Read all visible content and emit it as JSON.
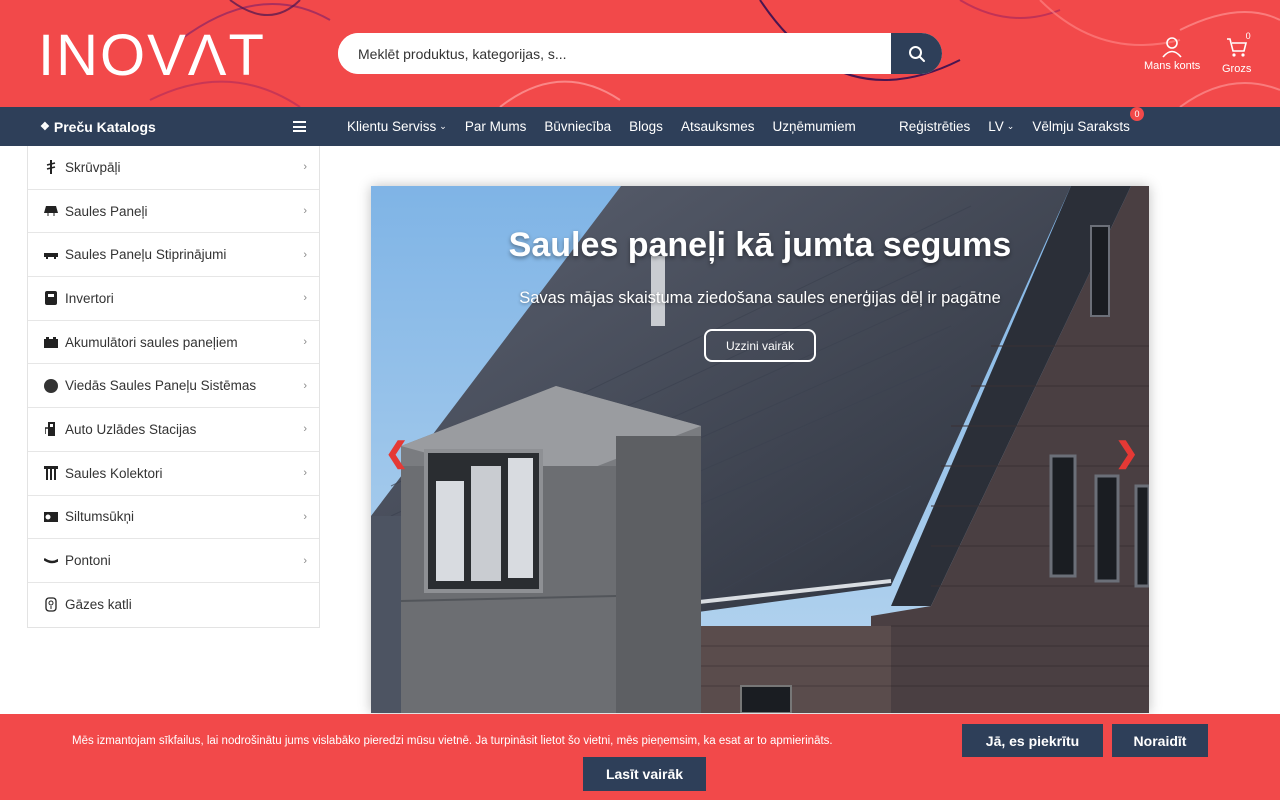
{
  "header": {
    "logo_text": "INOVΛT",
    "search": {
      "placeholder": "Meklēt produktus, kategorijas, s...",
      "value": ""
    },
    "account_label": "Mans konts",
    "cart_label": "Grozs",
    "cart_count": "0"
  },
  "nav": {
    "catalog_label": "Preču Katalogs",
    "items": [
      {
        "label": "Klientu Serviss",
        "has_dropdown": true
      },
      {
        "label": "Par Mums",
        "has_dropdown": false
      },
      {
        "label": "Būvniecība",
        "has_dropdown": false
      },
      {
        "label": "Blogs",
        "has_dropdown": false
      },
      {
        "label": "Atsauksmes",
        "has_dropdown": false
      },
      {
        "label": "Uzņēmumiem",
        "has_dropdown": false
      }
    ],
    "right": {
      "register_label": "Reģistrēties",
      "language_label": "LV",
      "wishlist_label": "Vēlmju Saraksts",
      "wishlist_count": "0"
    }
  },
  "sidebar": {
    "items": [
      {
        "label": "Skrūvpāļi",
        "icon": "screw-pile-icon"
      },
      {
        "label": "Saules Paneļi",
        "icon": "solar-panel-icon"
      },
      {
        "label": "Saules Paneļu Stiprinājumi",
        "icon": "mount-icon"
      },
      {
        "label": "Invertori",
        "icon": "inverter-icon"
      },
      {
        "label": "Akumulātori saules paneļiem",
        "icon": "battery-icon"
      },
      {
        "label": "Viedās Saules Paneļu Sistēmas",
        "icon": "smart-system-icon"
      },
      {
        "label": "Auto Uzlādes Stacijas",
        "icon": "ev-charger-icon"
      },
      {
        "label": "Saules Kolektori",
        "icon": "solar-collector-icon"
      },
      {
        "label": "Siltumsūkņi",
        "icon": "heat-pump-icon"
      },
      {
        "label": "Pontoni",
        "icon": "pontoon-icon"
      },
      {
        "label": "Gāzes katli",
        "icon": "gas-boiler-icon"
      }
    ]
  },
  "hero": {
    "title": "Saules paneļi kā jumta segums",
    "subtitle": "Savas mājas skaistuma ziedošana saules enerģijas dēļ ir pagātne",
    "button_label": "Uzzini vairāk",
    "prev_icon": "chevron-left-icon",
    "next_icon": "chevron-right-icon"
  },
  "cookie": {
    "text": "Mēs izmantojam sīkfailus, lai nodrošinātu jums vislabāko pieredzi mūsu vietnē. Ja turpināsit lietot šo vietni, mēs pieņemsim, ka esat ar to apmierināts.",
    "accept_label": "Jā, es piekrītu",
    "decline_label": "Noraidīt",
    "more_label": "Lasīt vairāk"
  },
  "colors": {
    "brand_red": "#f2494a",
    "navy": "#2e3f59"
  }
}
